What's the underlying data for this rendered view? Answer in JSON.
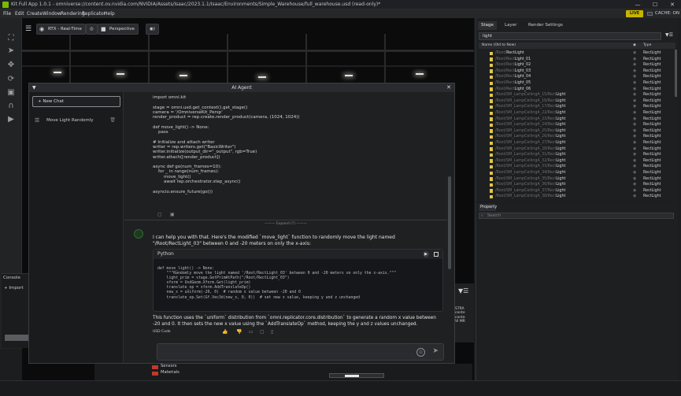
{
  "window": {
    "title": "Kit Full App 1.0.1 - omniverse://content.ov.nvidia.com/NVIDIA/Assets/Isaac/2023.1.1/Isaac/Environments/Simple_Warehouse/full_warehouse.usd (read-only)*",
    "minimize": "—",
    "maximize": "☐",
    "close": "✕"
  },
  "menu": [
    "File",
    "Edit",
    "Create",
    "Window",
    "Rendering",
    "Replicator",
    "Help"
  ],
  "live_badge": "LIVE",
  "cache_label": "CACHE: ON",
  "viewport": {
    "render_mode": "RTX - Real-Time",
    "camera": "Perspective"
  },
  "agent": {
    "title": "AI Agent",
    "new_chat": "+ New Chat",
    "chat_item": "Move Light Randomly",
    "prior_code": "import omni.kit\n\nstage = omni.usd.get_context().get_stage()\ncamera = '/OmniverseKit_Persp'\nrender_product = rep.create.render_product(camera, (1024, 1024))\n\ndef move_light() -> None:\n    pass\n\n# Initialize and attach writer\nwriter = rep.writers.get(\"BasicWriter\")\nwriter.initialize(output_dir=\"_output\", rgb=True)\nwriter.attach([render_product])\n\nasync def go(num_frames=10):\n    for _ in range(num_frames):\n        move_light()\n        await rep.orchestrator.step_async()\n\nasyncio.ensure_future(go())",
    "expand_label": "——— Expand (?) ———",
    "reply_intro": "I can help you with that. Here's the modified `move_light` function to randomly move the light named \"/Root/RectLight_03\" between 0 and -20 meters on only the x-axis:",
    "code_lang": "Python",
    "code": "def move_light() -> None:\n    \"\"\"Randomly move the light named '/Root/RectLight_03' between 0 and -20 meters on only the x-axis.\"\"\"\n    light_prim = stage.GetPrimAtPath(\"/Root/RectLight_03\")\n    xform = UsdGeom.Xform.Get(light_prim)\n    translate_op = xform.AddTranslateOp()\n    new_x = uniform(-20, 0)  # random x value between -20 and 0\n    translate_op.Set(Gf.Vec3d(new_x, 0, 0))  # set new x value, keeping y and z unchanged",
    "reply_outro": "This function uses the `uniform` distribution from `omni.replicator.core.distribution` to generate a random x value between -20 and 0. It then sets the new x value using the `AddTranslateOp` method, keeping the y and z values unchanged.",
    "usd_code_label": "USD Code"
  },
  "console": {
    "label": "Console",
    "import_label": "+ Import"
  },
  "content_tree": [
    "Sensors",
    "Materials"
  ],
  "filter_text": "STRA\nconte\nconte\nVI MR",
  "stage": {
    "tabs": [
      "Stage",
      "Layer",
      "Render Settings"
    ],
    "search_value": "light",
    "col_name": "Name (Old to New)",
    "col_type": "Type",
    "rows": [
      {
        "path": "/Root/",
        "hl": "RectLight",
        "type": "RectLight"
      },
      {
        "path": "/Root/Rect",
        "hl": "Light_01",
        "type": "RectLight"
      },
      {
        "path": "/Root/Rect",
        "hl": "Light_02",
        "type": "RectLight"
      },
      {
        "path": "/Root/Rect",
        "hl": "Light_03",
        "type": "RectLight"
      },
      {
        "path": "/Root/Rect",
        "hl": "Light_04",
        "type": "RectLight"
      },
      {
        "path": "/Root/Rect",
        "hl": "Light_05",
        "type": "RectLight"
      },
      {
        "path": "/Root/Rect",
        "hl": "Light_06",
        "type": "RectLight"
      },
      {
        "path": "/Root/SM_LampCeilingA_15/Rect",
        "hl": "Light",
        "type": "RectLight"
      },
      {
        "path": "/Root/SM_LampCeilingA_16/Rect",
        "hl": "Light",
        "type": "RectLight"
      },
      {
        "path": "/Root/SM_LampCeilingA_17/Rect",
        "hl": "Light",
        "type": "RectLight"
      },
      {
        "path": "/Root/SM_LampCeilingA_22/Rect",
        "hl": "Light",
        "type": "RectLight"
      },
      {
        "path": "/Root/SM_LampCeilingA_23/Rect",
        "hl": "Light",
        "type": "RectLight"
      },
      {
        "path": "/Root/SM_LampCeilingA_24/Rect",
        "hl": "Light",
        "type": "RectLight"
      },
      {
        "path": "/Root/SM_LampCeilingA_25/Rect",
        "hl": "Light",
        "type": "RectLight"
      },
      {
        "path": "/Root/SM_LampCeilingA_26/Rect",
        "hl": "Light",
        "type": "RectLight"
      },
      {
        "path": "/Root/SM_LampCeilingA_27/Rect",
        "hl": "Light",
        "type": "RectLight"
      },
      {
        "path": "/Root/SM_LampCeilingA_28/Rect",
        "hl": "Light",
        "type": "RectLight"
      },
      {
        "path": "/Root/SM_LampCeilingA_31/Rect",
        "hl": "Light",
        "type": "RectLight"
      },
      {
        "path": "/Root/SM_LampCeilingA_32/Rect",
        "hl": "Light",
        "type": "RectLight"
      },
      {
        "path": "/Root/SM_LampCeilingA_33/Rect",
        "hl": "Light",
        "type": "RectLight"
      },
      {
        "path": "/Root/SM_LampCeilingA_34/Rect",
        "hl": "Light",
        "type": "RectLight"
      },
      {
        "path": "/Root/SM_LampCeilingA_35/Rect",
        "hl": "Light",
        "type": "RectLight"
      },
      {
        "path": "/Root/SM_LampCeilingA_36/Rect",
        "hl": "Light",
        "type": "RectLight"
      },
      {
        "path": "/Root/SM_LampCeilingA_37/Rect",
        "hl": "Light",
        "type": "RectLight"
      },
      {
        "path": "/Root/SM_LampCeilingA_38/Rect",
        "hl": "Light",
        "type": "RectLight"
      }
    ]
  },
  "property": {
    "tab": "Property",
    "search_placeholder": "Search"
  }
}
